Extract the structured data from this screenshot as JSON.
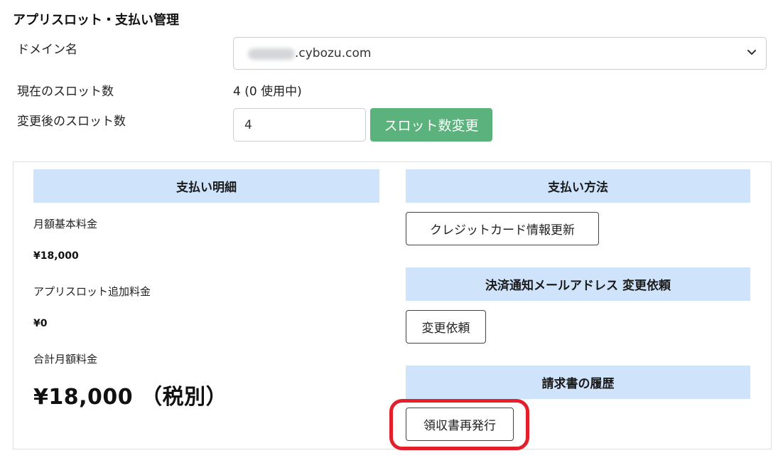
{
  "page": {
    "title": "アプリスロット・支払い管理"
  },
  "form": {
    "domain_label": "ドメイン名",
    "domain_value": ".cybozu.com",
    "current_slots_label": "現在のスロット数",
    "current_slots_value": "4 (0 使用中)",
    "new_slots_label": "変更後のスロット数",
    "new_slots_value": "4",
    "change_slots_button": "スロット数変更"
  },
  "payment_details": {
    "header": "支払い明細",
    "monthly_base_label": "月額基本料金",
    "monthly_base_value": "¥18,000",
    "slot_fee_label": "アプリスロット追加料金",
    "slot_fee_value": "¥0",
    "total_label": "合計月額料金",
    "total_value": "¥18,000 （税別）"
  },
  "payment_method": {
    "header": "支払い方法",
    "update_card_button": "クレジットカード情報更新"
  },
  "notification_email": {
    "header": "決済通知メールアドレス 変更依頼",
    "request_button": "変更依頼"
  },
  "invoice_history": {
    "header": "請求書の履歴",
    "reissue_button": "領収書再発行"
  },
  "colors": {
    "header_bg": "#cfe3fa",
    "primary_green": "#5cb27c",
    "highlight_red": "#e41e2b"
  }
}
